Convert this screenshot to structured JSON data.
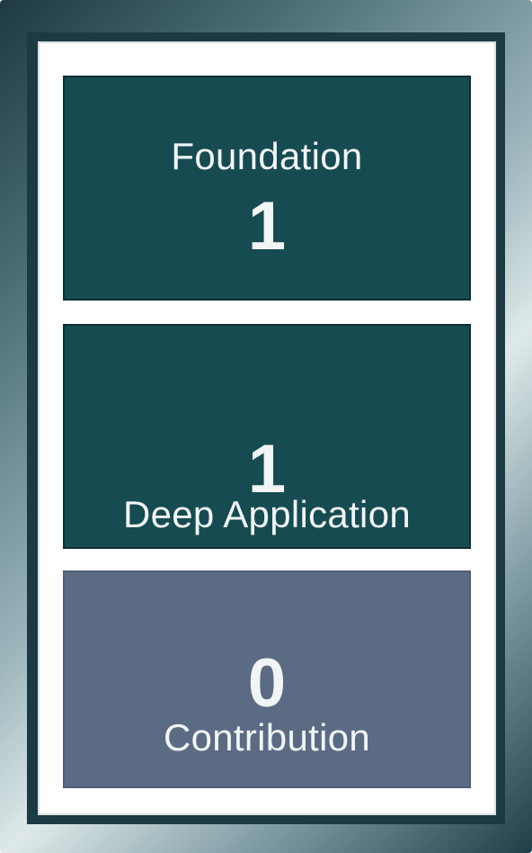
{
  "colors": {
    "primary_tile": "#164b52",
    "secondary_tile": "#5c6b84",
    "frame_dark": "#1c3a44",
    "panel_background": "#ffffff",
    "text": "#f2f5f6"
  },
  "tiles": [
    {
      "label": "Foundation",
      "value": "1"
    },
    {
      "label": "Deep Application",
      "value": "1"
    },
    {
      "label": "Contribution",
      "value": "0"
    }
  ]
}
